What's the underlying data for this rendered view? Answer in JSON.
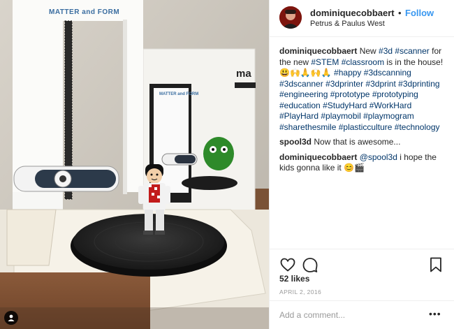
{
  "post": {
    "photo": {
      "scanner_brand_front": "MATTER and FORM",
      "scanner_brand_box": "MATTER and FORM",
      "box_partial_logo": "ma"
    },
    "header": {
      "username": "dominiquecobbaert",
      "dot": "•",
      "follow_label": "Follow",
      "location": "Petrus & Paulus West"
    },
    "comments": [
      {
        "username": "dominiquecobbaert",
        "text_plain": "New ",
        "segments": [
          {
            "t": "text",
            "v": "New "
          },
          {
            "t": "tag",
            "v": "#3d"
          },
          {
            "t": "text",
            "v": " "
          },
          {
            "t": "tag",
            "v": "#scanner"
          },
          {
            "t": "text",
            "v": " for the new "
          },
          {
            "t": "tag",
            "v": "#STEM"
          },
          {
            "t": "text",
            "v": " "
          },
          {
            "t": "tag",
            "v": "#classroom"
          },
          {
            "t": "text",
            "v": " is in the house! 😃🙌🙏🙌🙏 "
          },
          {
            "t": "tag",
            "v": "#happy"
          },
          {
            "t": "text",
            "v": " "
          },
          {
            "t": "tag",
            "v": "#3dscanning"
          },
          {
            "t": "text",
            "v": " "
          },
          {
            "t": "tag",
            "v": "#3dscanner"
          },
          {
            "t": "text",
            "v": " "
          },
          {
            "t": "tag",
            "v": "#3dprinter"
          },
          {
            "t": "text",
            "v": " "
          },
          {
            "t": "tag",
            "v": "#3dprint"
          },
          {
            "t": "text",
            "v": " "
          },
          {
            "t": "tag",
            "v": "#3dprinting"
          },
          {
            "t": "text",
            "v": " "
          },
          {
            "t": "tag",
            "v": "#engineering"
          },
          {
            "t": "text",
            "v": " "
          },
          {
            "t": "tag",
            "v": "#prototype"
          },
          {
            "t": "text",
            "v": " "
          },
          {
            "t": "tag",
            "v": "#prototyping"
          },
          {
            "t": "text",
            "v": " "
          },
          {
            "t": "tag",
            "v": "#education"
          },
          {
            "t": "text",
            "v": " "
          },
          {
            "t": "tag",
            "v": "#StudyHard"
          },
          {
            "t": "text",
            "v": " "
          },
          {
            "t": "tag",
            "v": "#WorkHard"
          },
          {
            "t": "text",
            "v": " "
          },
          {
            "t": "tag",
            "v": "#PlayHard"
          },
          {
            "t": "text",
            "v": " "
          },
          {
            "t": "tag",
            "v": "#playmobil"
          },
          {
            "t": "text",
            "v": " "
          },
          {
            "t": "tag",
            "v": "#playmogram"
          },
          {
            "t": "text",
            "v": " "
          },
          {
            "t": "tag",
            "v": "#sharethesmile"
          },
          {
            "t": "text",
            "v": " "
          },
          {
            "t": "tag",
            "v": "#plasticculture"
          },
          {
            "t": "text",
            "v": " "
          },
          {
            "t": "tag",
            "v": "#technology"
          }
        ]
      },
      {
        "username": "spool3d",
        "segments": [
          {
            "t": "text",
            "v": "Now that is awesome..."
          }
        ]
      },
      {
        "username": "dominiquecobbaert",
        "segments": [
          {
            "t": "tag",
            "v": "@spool3d"
          },
          {
            "t": "text",
            "v": " i hope the kids gonna like it 😊🎬"
          }
        ]
      }
    ],
    "likes": "52 likes",
    "date": "APRIL 2, 2016",
    "add_comment_placeholder": "Add a comment...",
    "more_label": "•••"
  },
  "icons": {
    "like": "heart-icon",
    "comment": "comment-bubble-icon",
    "save": "bookmark-icon",
    "tagged_user": "user-tag-icon",
    "more": "more-options-icon"
  },
  "colors": {
    "link_blue": "#3897f0",
    "hashtag": "#003569",
    "text": "#262626",
    "muted": "#999999",
    "border": "#efefef"
  }
}
